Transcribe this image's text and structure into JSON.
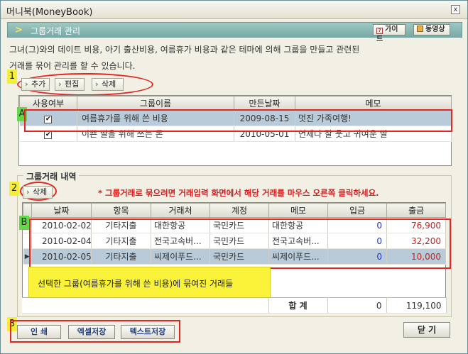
{
  "window": {
    "title": "머니북(MoneyBook)",
    "close_glyph": "x"
  },
  "header": {
    "title": "그룹거래 관리",
    "guide_label": "가이드",
    "video_label": "동영상"
  },
  "description": {
    "line1": "그녀(그)와의 데이트 비용, 아기 출산비용, 여름휴가 비용과 같은 테마에 의해 그룹을 만들고 관련된",
    "line2": "거래를 묶어 관리를 할 수 있습니다."
  },
  "markers": {
    "m1": "1",
    "m2": "2",
    "m3": "3",
    "mA": "A",
    "mB": "B"
  },
  "group_toolbar": {
    "add": "추가",
    "edit": "편집",
    "delete": "삭제"
  },
  "group_table": {
    "columns": [
      "사용여부",
      "그룹이름",
      "만든날짜",
      "메모"
    ],
    "rows": [
      {
        "checked": "✔",
        "name": "여름휴가를 위해 쓴 비용",
        "date": "2009-08-15",
        "memo": "멋진 가족여행!"
      },
      {
        "checked": "✔",
        "name": "이쁜 딸을 위해 쓰는 돈",
        "date": "2010-05-01",
        "memo": "언제나 잘 웃고 귀여운 딸"
      }
    ]
  },
  "detail": {
    "legend": "그룹거래 내역",
    "delete": "삭제",
    "notice": "* 그룹거래로 묶으려면 거래입력 화면에서 해당 거래를 마우스 오른쪽 클릭하세요.",
    "columns": [
      "날짜",
      "항목",
      "거래처",
      "계정",
      "메모",
      "입금",
      "출금"
    ],
    "rows": [
      {
        "date": "2010-02-02",
        "item": "기타지출",
        "vendor": "대한항공",
        "account": "국민카드",
        "memo": "대한항공",
        "deposit": "0",
        "withdraw": "76,900"
      },
      {
        "date": "2010-02-04",
        "item": "기타지출",
        "vendor": "전국고속버...",
        "account": "국민카드",
        "memo": "전국고속버...",
        "deposit": "0",
        "withdraw": "32,200"
      },
      {
        "date": "2010-02-05",
        "item": "기타지출",
        "vendor": "씨제이푸드...",
        "account": "국민카드",
        "memo": "씨제이푸드...",
        "deposit": "0",
        "withdraw": "10,000"
      }
    ],
    "tooltip": "선택한 그룹(여름휴가를 위해 쓴 비용)에 묶여진 거래들",
    "totals": {
      "label": "합 계",
      "deposit": "0",
      "withdraw": "119,100"
    }
  },
  "bottom": {
    "print": "인 쇄",
    "excel": "엑셀저장",
    "text": "텍스트저장",
    "close": "닫 기"
  },
  "colors": {
    "header": "#79aaa6",
    "highlight": "#e3261f",
    "selected_row": "#b9cbd8",
    "tooltip": "#fbf33a"
  }
}
